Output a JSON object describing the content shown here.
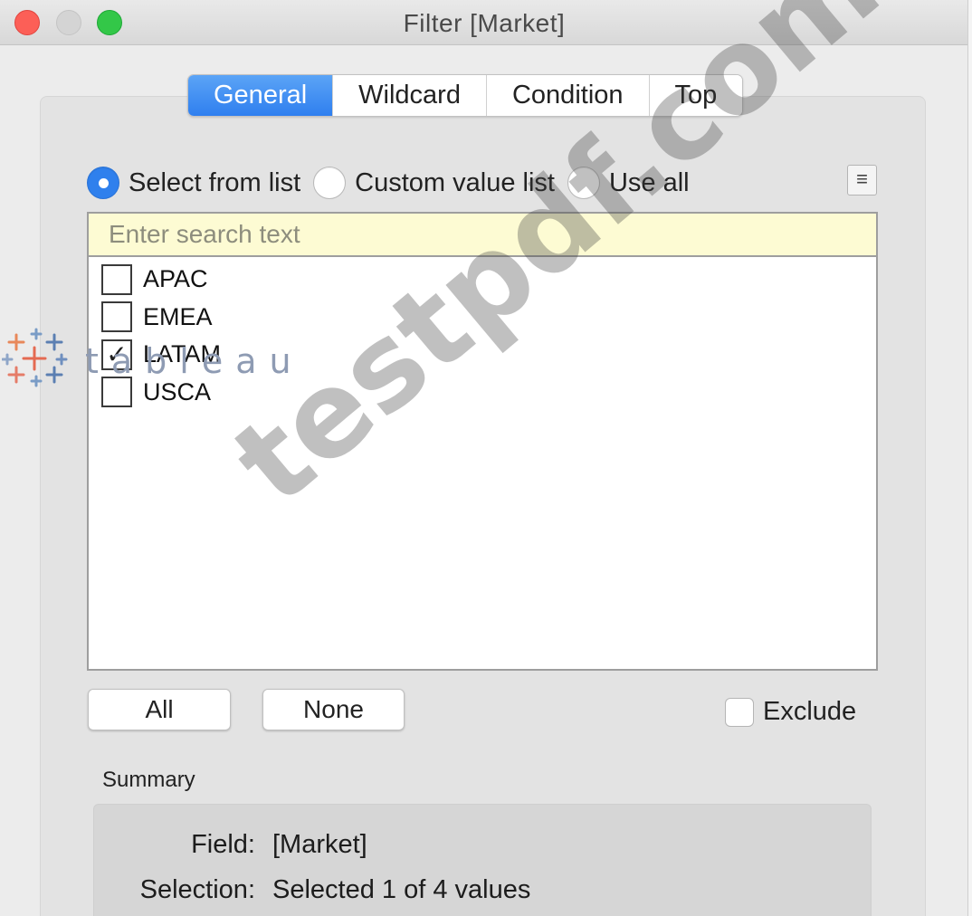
{
  "window": {
    "title": "Filter [Market]"
  },
  "tabs": [
    {
      "label": "General",
      "active": true
    },
    {
      "label": "Wildcard",
      "active": false
    },
    {
      "label": "Condition",
      "active": false
    },
    {
      "label": "Top",
      "active": false
    }
  ],
  "mode": {
    "options": [
      {
        "label": "Select from list",
        "selected": true
      },
      {
        "label": "Custom value list",
        "selected": false
      },
      {
        "label": "Use all",
        "selected": false
      }
    ]
  },
  "list": {
    "search_placeholder": "Enter search text",
    "items": [
      {
        "label": "APAC",
        "checked": false
      },
      {
        "label": "EMEA",
        "checked": false
      },
      {
        "label": "LATAM",
        "checked": true
      },
      {
        "label": "USCA",
        "checked": false
      }
    ]
  },
  "buttons": {
    "all": "All",
    "none": "None"
  },
  "exclude": {
    "label": "Exclude",
    "checked": false
  },
  "summary": {
    "title": "Summary",
    "field_key": "Field:",
    "field_value": "[Market]",
    "selection_key": "Selection:",
    "selection_value": "Selected 1 of 4 values"
  },
  "watermarks": {
    "logo_text": "tableau",
    "text": "testpdf.com"
  },
  "colors": {
    "accent": "#2f80ed",
    "search_bg": "#fdfbd3"
  }
}
